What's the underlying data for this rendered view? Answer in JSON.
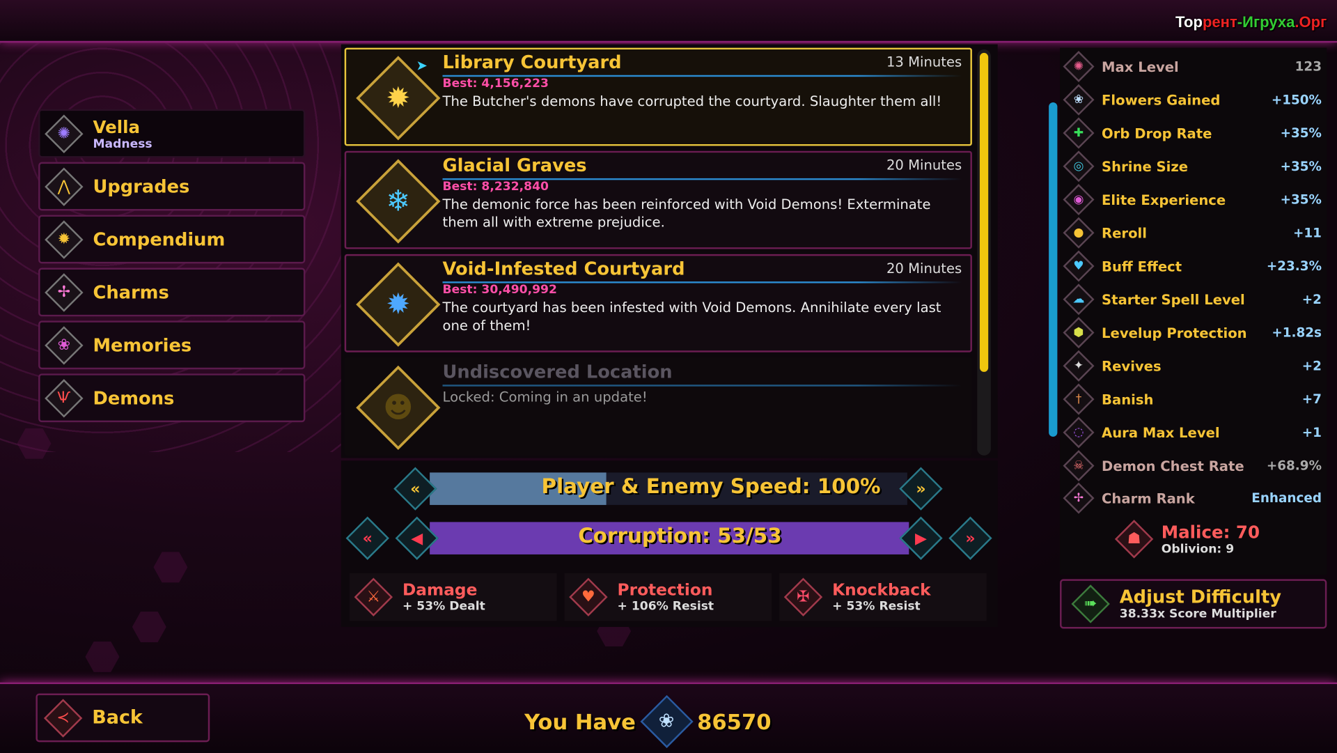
{
  "watermark": {
    "part1": "Тор",
    "part2": "рент",
    "part3": "-Игруха",
    "part4": ".Орг"
  },
  "menu": {
    "character": {
      "name": "Vella",
      "subtitle": "Madness",
      "icon": "vella-sigil-icon"
    },
    "items": [
      {
        "label": "Upgrades",
        "icon": "upgrades-arrow-icon"
      },
      {
        "label": "Compendium",
        "icon": "open-book-icon"
      },
      {
        "label": "Charms",
        "icon": "charm-icon"
      },
      {
        "label": "Memories",
        "icon": "brain-icon"
      },
      {
        "label": "Demons",
        "icon": "demon-icon"
      }
    ]
  },
  "levels": [
    {
      "title": "Library Courtyard",
      "time": "13 Minutes",
      "best": "Best: 4,156,223",
      "desc": "The Butcher's demons have corrupted the courtyard. Slaughter them all!",
      "icon": "flaming-book-icon",
      "selected": true
    },
    {
      "title": "Glacial Graves",
      "time": "20 Minutes",
      "best": "Best: 8,232,840",
      "desc": "The demonic force has been reinforced with Void Demons! Exterminate them all with extreme prejudice.",
      "icon": "snowflake-icon"
    },
    {
      "title": "Void-Infested Courtyard",
      "time": "20 Minutes",
      "best": "Best: 30,490,992",
      "desc": "The courtyard has been infested with Void Demons. Annihilate every last one of them!",
      "icon": "void-book-icon"
    },
    {
      "title": "Undiscovered Location",
      "time": "",
      "best": "",
      "desc": "Locked: Coming in an update!",
      "icon": "locked-demon-face-icon",
      "locked": true
    }
  ],
  "speed": {
    "label": "Player & Enemy Speed: 100%",
    "fill": 0.37
  },
  "corruption": {
    "label": "Corruption: 53/53",
    "value": 53,
    "max": 53
  },
  "modifiers": [
    {
      "name": "Damage",
      "value": "+ 53% Dealt",
      "icon": "sword-icon"
    },
    {
      "name": "Protection",
      "value": "+ 106% Resist",
      "icon": "heart-shield-icon"
    },
    {
      "name": "Knockback",
      "value": "+ 53% Resist",
      "icon": "knockback-shield-icon"
    }
  ],
  "stats": [
    {
      "name": "Max Level",
      "value": "123",
      "icon": "max-level-icon",
      "dim": true
    },
    {
      "name": "Flowers Gained",
      "value": "+150%",
      "icon": "flower-icon"
    },
    {
      "name": "Orb Drop Rate",
      "value": "+35%",
      "icon": "orb-cross-icon"
    },
    {
      "name": "Shrine Size",
      "value": "+35%",
      "icon": "shrine-icon"
    },
    {
      "name": "Elite Experience",
      "value": "+35%",
      "icon": "elite-icon"
    },
    {
      "name": "Reroll",
      "value": "+11",
      "icon": "dice-bag-icon"
    },
    {
      "name": "Buff Effect",
      "value": "+23.3%",
      "icon": "buff-heart-icon"
    },
    {
      "name": "Starter Spell Level",
      "value": "+2",
      "icon": "spell-icon"
    },
    {
      "name": "Levelup Protection",
      "value": "+1.82s",
      "icon": "levelup-shield-icon"
    },
    {
      "name": "Revives",
      "value": "+2",
      "icon": "wings-icon"
    },
    {
      "name": "Banish",
      "value": "+7",
      "icon": "banish-dagger-icon"
    },
    {
      "name": "Aura Max Level",
      "value": "+1",
      "icon": "aura-icon"
    },
    {
      "name": "Demon Chest Rate",
      "value": "+68.9%",
      "icon": "demon-chest-icon",
      "dim": true
    },
    {
      "name": "Charm Rank",
      "value": "Enhanced",
      "icon": "charm-rank-icon",
      "dim": true
    }
  ],
  "malice": {
    "label": "Malice: 70",
    "sub": "Oblivion: 9",
    "icon": "malice-mask-icon"
  },
  "adjust": {
    "label": "Adjust Difficulty",
    "sub": "38.33x Score Multiplier",
    "icon": "adjust-arrow-icon"
  },
  "back": {
    "label": "Back",
    "icon": "back-arrow-icon"
  },
  "currency": {
    "label": "You Have",
    "value": "86570",
    "icon": "flower-currency-icon"
  }
}
